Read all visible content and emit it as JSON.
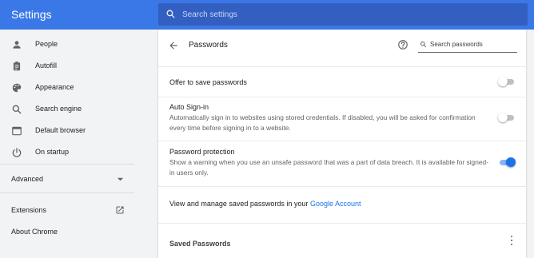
{
  "app": {
    "title": "Settings"
  },
  "search": {
    "placeholder": "Search settings"
  },
  "sidebar": {
    "items": [
      {
        "label": "People",
        "icon": "person-icon"
      },
      {
        "label": "Autofill",
        "icon": "clipboard-icon"
      },
      {
        "label": "Appearance",
        "icon": "palette-icon"
      },
      {
        "label": "Search engine",
        "icon": "search-icon"
      },
      {
        "label": "Default browser",
        "icon": "browser-icon"
      },
      {
        "label": "On startup",
        "icon": "power-icon"
      }
    ],
    "advanced": "Advanced",
    "extensions": "Extensions",
    "about": "About Chrome"
  },
  "passwords": {
    "title": "Passwords",
    "search_placeholder": "Search passwords",
    "offer_to_save": {
      "title": "Offer to save passwords",
      "enabled": false
    },
    "auto_signin": {
      "title": "Auto Sign-in",
      "desc": "Automatically sign in to websites using stored credentials. If disabled, you will be asked for confirmation every time before signing in to a website.",
      "enabled": false
    },
    "protection": {
      "title": "Password protection",
      "desc": "Show a warning when you use an unsafe password that was a part of data breach. It is available for signed-in users only.",
      "enabled": true
    },
    "manage_text": "View and manage saved passwords in your ",
    "manage_link": "Google Account",
    "saved_title": "Saved Passwords"
  },
  "colors": {
    "header": "#3b78e7",
    "search_bg": "#335fc1",
    "accent": "#1a73e8",
    "background": "#f1f3f4"
  }
}
